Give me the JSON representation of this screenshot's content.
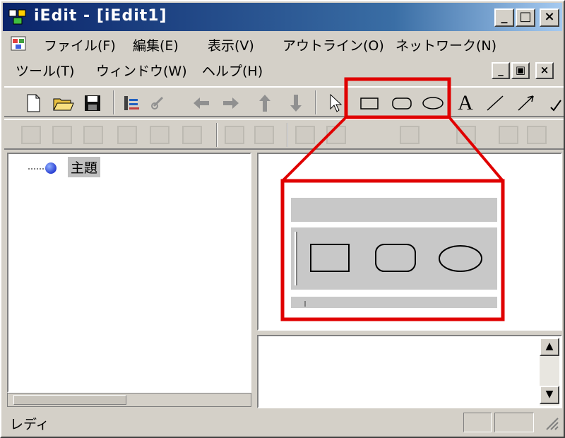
{
  "window": {
    "title": "iEdit - [iEdit1]",
    "minimize_glyph": "_",
    "maximize_glyph": "□",
    "close_glyph": "×",
    "title_icon": "app-icon"
  },
  "menu": {
    "items": [
      "ファイル(F)",
      "編集(E)",
      "表示(V)",
      "アウトライン(O)",
      "ネットワーク(N)",
      "ツール(T)",
      "ウィンドウ(W)",
      "ヘルプ(H)"
    ],
    "mdi_min": "_",
    "mdi_restore": "▣",
    "mdi_close": "×"
  },
  "toolbar_icons": [
    "new-file-icon",
    "open-folder-icon",
    "save-icon",
    "outline-icon",
    "link-icon",
    "arrow-left-icon",
    "arrow-right-icon",
    "arrow-up-icon",
    "arrow-down-icon",
    "pointer-icon",
    "rectangle-icon",
    "rounded-rectangle-icon",
    "ellipse-icon",
    "text-icon",
    "line-icon",
    "arrow-line-icon",
    "check-icon"
  ],
  "toolbar_text_glyph": "A",
  "tree": {
    "root_label": "主題"
  },
  "status": {
    "text": "レディ"
  },
  "scrollbar": {
    "up": "▲",
    "down": "▼"
  },
  "colors": {
    "highlight": "#e00000",
    "titlebar": "#0a246a",
    "face": "#d4d0c8"
  }
}
